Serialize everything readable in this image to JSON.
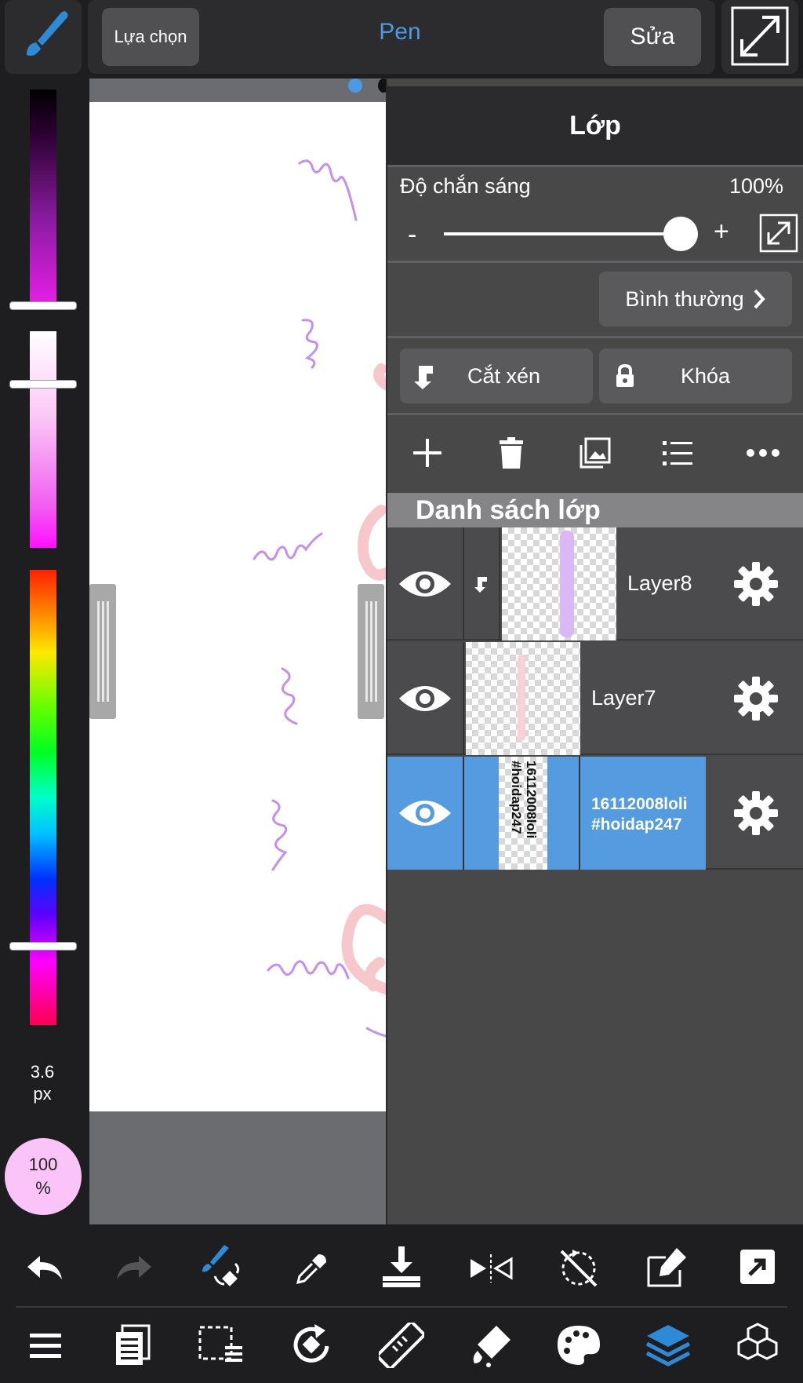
{
  "toolbar": {
    "brush_icon": "brush-icon",
    "select_label": "Lựa chọn",
    "tool_name": "Pen",
    "edit_label": "Sửa",
    "expand_icon": "expand-icon"
  },
  "color_bar": {
    "brush_size": "3.6",
    "brush_unit": "px",
    "opacity_value": "100",
    "opacity_unit": "%",
    "current_color": "#fbc4f8"
  },
  "layer_panel": {
    "title": "Lớp",
    "opacity_label": "Độ chắn sáng",
    "opacity_value": "100%",
    "minus_label": "-",
    "plus_label": "+",
    "opacity_fraction": 1.0,
    "blend_mode": "Bình thường",
    "clip_label": "Cắt xén",
    "lock_label": "Khóa",
    "list_header": "Danh sách lớp",
    "layers": [
      {
        "name": "Layer8",
        "visible": true,
        "clipped": true,
        "selected": false
      },
      {
        "name": "Layer7",
        "visible": true,
        "clipped": false,
        "selected": false
      },
      {
        "name": "16112008loli\n#hoidap247",
        "name_line1": "16112008loli",
        "name_line2": "#hoidap247",
        "visible": true,
        "clipped": false,
        "selected": true
      }
    ],
    "selected_color": "#559be0"
  },
  "bottom_tools": {
    "row1": [
      "undo-icon",
      "redo-icon",
      "brush-transform-icon",
      "eyedropper-icon",
      "import-icon",
      "flip-icon",
      "rotate-lock-icon",
      "edit-export-icon",
      "share-icon"
    ],
    "row2": [
      "menu-icon",
      "pages-icon",
      "selection-icon",
      "rotate-canvas-icon",
      "ruler-icon",
      "fill-icon",
      "palette-icon",
      "layers-icon",
      "materials-icon"
    ],
    "active_color": "#2d8ad6"
  }
}
